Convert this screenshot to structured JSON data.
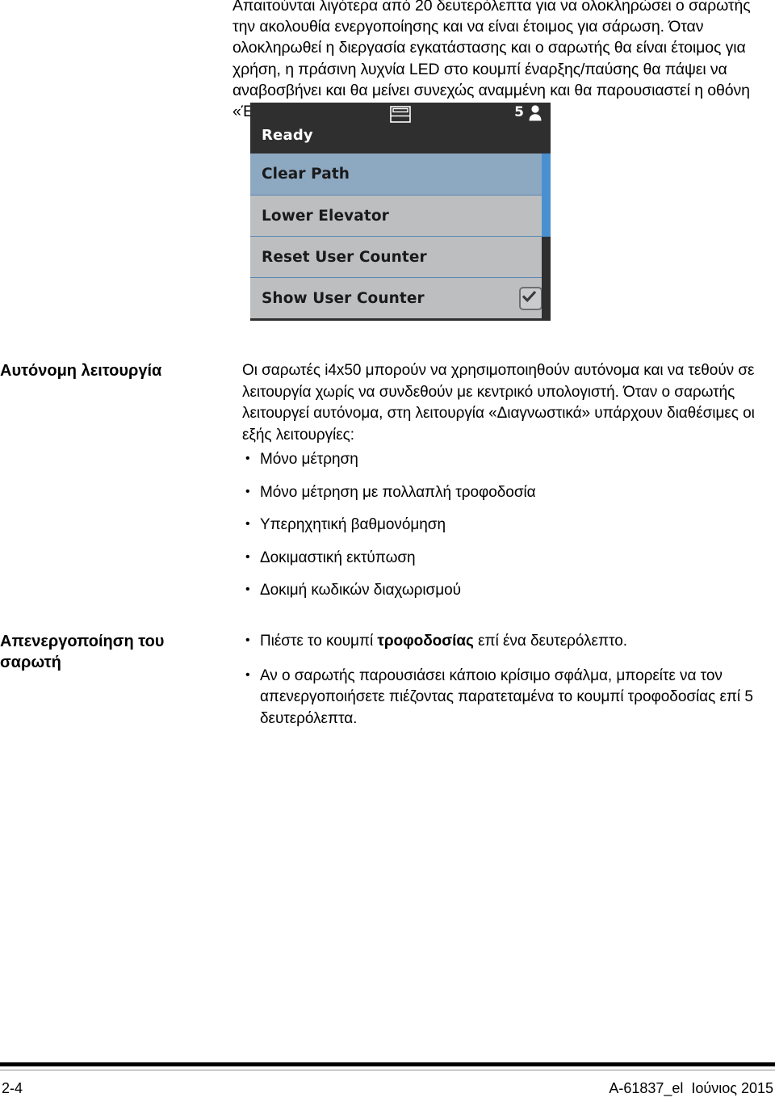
{
  "intro": {
    "paragraph": "Απαιτούνται λιγότερα από 20 δευτερόλεπτα για να ολοκληρώσει ο σαρωτής την ακολουθία ενεργοποίησης και να είναι έτοιμος για σάρωση. Όταν ολοκληρωθεί η διεργασία εγκατάστασης και ο σαρωτής θα είναι έτοιμος για χρήση, η πράσινη λυχνία LED στο κουμπί έναρξης/παύσης θα πάψει να αναβοσβήνει και θα μείνει συνεχώς αναμμένη και θα παρουσιαστεί η οθόνη «Έτοιμος»."
  },
  "device_screen": {
    "status_bar": {
      "center_icon": "document-tray-icon",
      "user_count": "5",
      "user_icon": "user-icon"
    },
    "state_label": "Ready",
    "menu_items": [
      {
        "label": "Clear Path",
        "selected": true,
        "checkbox": false
      },
      {
        "label": "Lower Elevator",
        "selected": false,
        "checkbox": false
      },
      {
        "label": "Reset User Counter",
        "selected": false,
        "checkbox": false
      },
      {
        "label": "Show User Counter",
        "selected": false,
        "checkbox": true
      }
    ],
    "colors": {
      "bar_background": "#2f2f2f",
      "row_background": "#bcbec0",
      "row_selected": "#8da8c1",
      "row_divider": "#5a87b5",
      "scrollbar_thumb": "#4a90cf"
    }
  },
  "sections": [
    {
      "heading": "Αυτόνομη λειτουργία",
      "paragraph": "Οι σαρωτές i4x50 μπορούν να χρησιμοποιηθούν αυτόνομα και να τεθούν σε λειτουργία χωρίς να συνδεθούν με κεντρικό υπολογιστή. Όταν ο σαρωτής λειτουργεί αυτόνομα, στη λειτουργία «Διαγνωστικά» υπάρχουν διαθέσιμες οι εξής λειτουργίες:",
      "bullets": [
        "Μόνο μέτρηση",
        "Μόνο μέτρηση με πολλαπλή τροφοδοσία",
        "Υπερηχητική βαθμονόμηση",
        "Δοκιμαστική εκτύπωση",
        "Δοκιμή κωδικών διαχωρισμού"
      ]
    },
    {
      "heading": "Απενεργοποίηση του σαρωτή",
      "bullets_rich": [
        {
          "before": "Πιέστε το κουμπί ",
          "bold": "τροφοδοσίας",
          "after": " επί ένα δευτερόλεπτο."
        },
        {
          "before": "Αν ο σαρωτής παρουσιάσει κάποιο κρίσιμο σφάλμα, μπορείτε να τον απενεργοποιήσετε πιέζοντας παρατεταμένα το κουμπί τροφοδοσίας επί 5 δευτερόλεπτα.",
          "bold": "",
          "after": ""
        }
      ]
    }
  ],
  "footer": {
    "page_number": "2-4",
    "document_id": "A-61837_el  Ιούνιος 2015"
  }
}
